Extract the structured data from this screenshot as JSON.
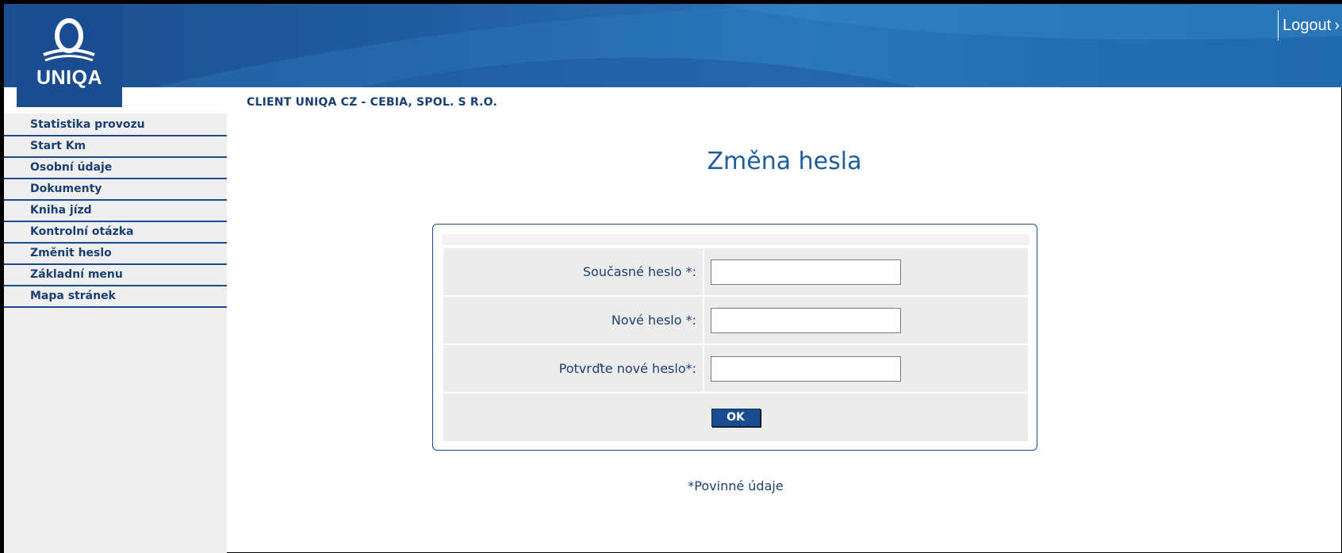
{
  "header": {
    "logo_text": "UNIQA",
    "logout_label": "Logout",
    "logout_chevron": "›"
  },
  "client_line": "CLIENT UNIQA CZ - CEBIA, SPOL. S R.O.",
  "sidebar": {
    "items": [
      {
        "label": "Statistika provozu"
      },
      {
        "label": "Start Km"
      },
      {
        "label": "Osobní údaje"
      },
      {
        "label": "Dokumenty"
      },
      {
        "label": "Kniha jízd"
      },
      {
        "label": "Kontrolní otázka"
      },
      {
        "label": "Změnit heslo"
      },
      {
        "label": "Základní menu"
      },
      {
        "label": "Mapa stránek"
      }
    ]
  },
  "main": {
    "title": "Změna hesla",
    "form": {
      "current_password_label": "Současné heslo *:",
      "current_password_value": "",
      "new_password_label": "Nové heslo *:",
      "new_password_value": "",
      "confirm_password_label": "Potvrďte nové heslo*:",
      "confirm_password_value": "",
      "ok_label": "OK"
    },
    "required_note": "*Povinné údaje"
  },
  "colors": {
    "brand_blue": "#1a4d8f",
    "text_blue": "#1a3f73",
    "sidebar_bg": "#efefef"
  }
}
